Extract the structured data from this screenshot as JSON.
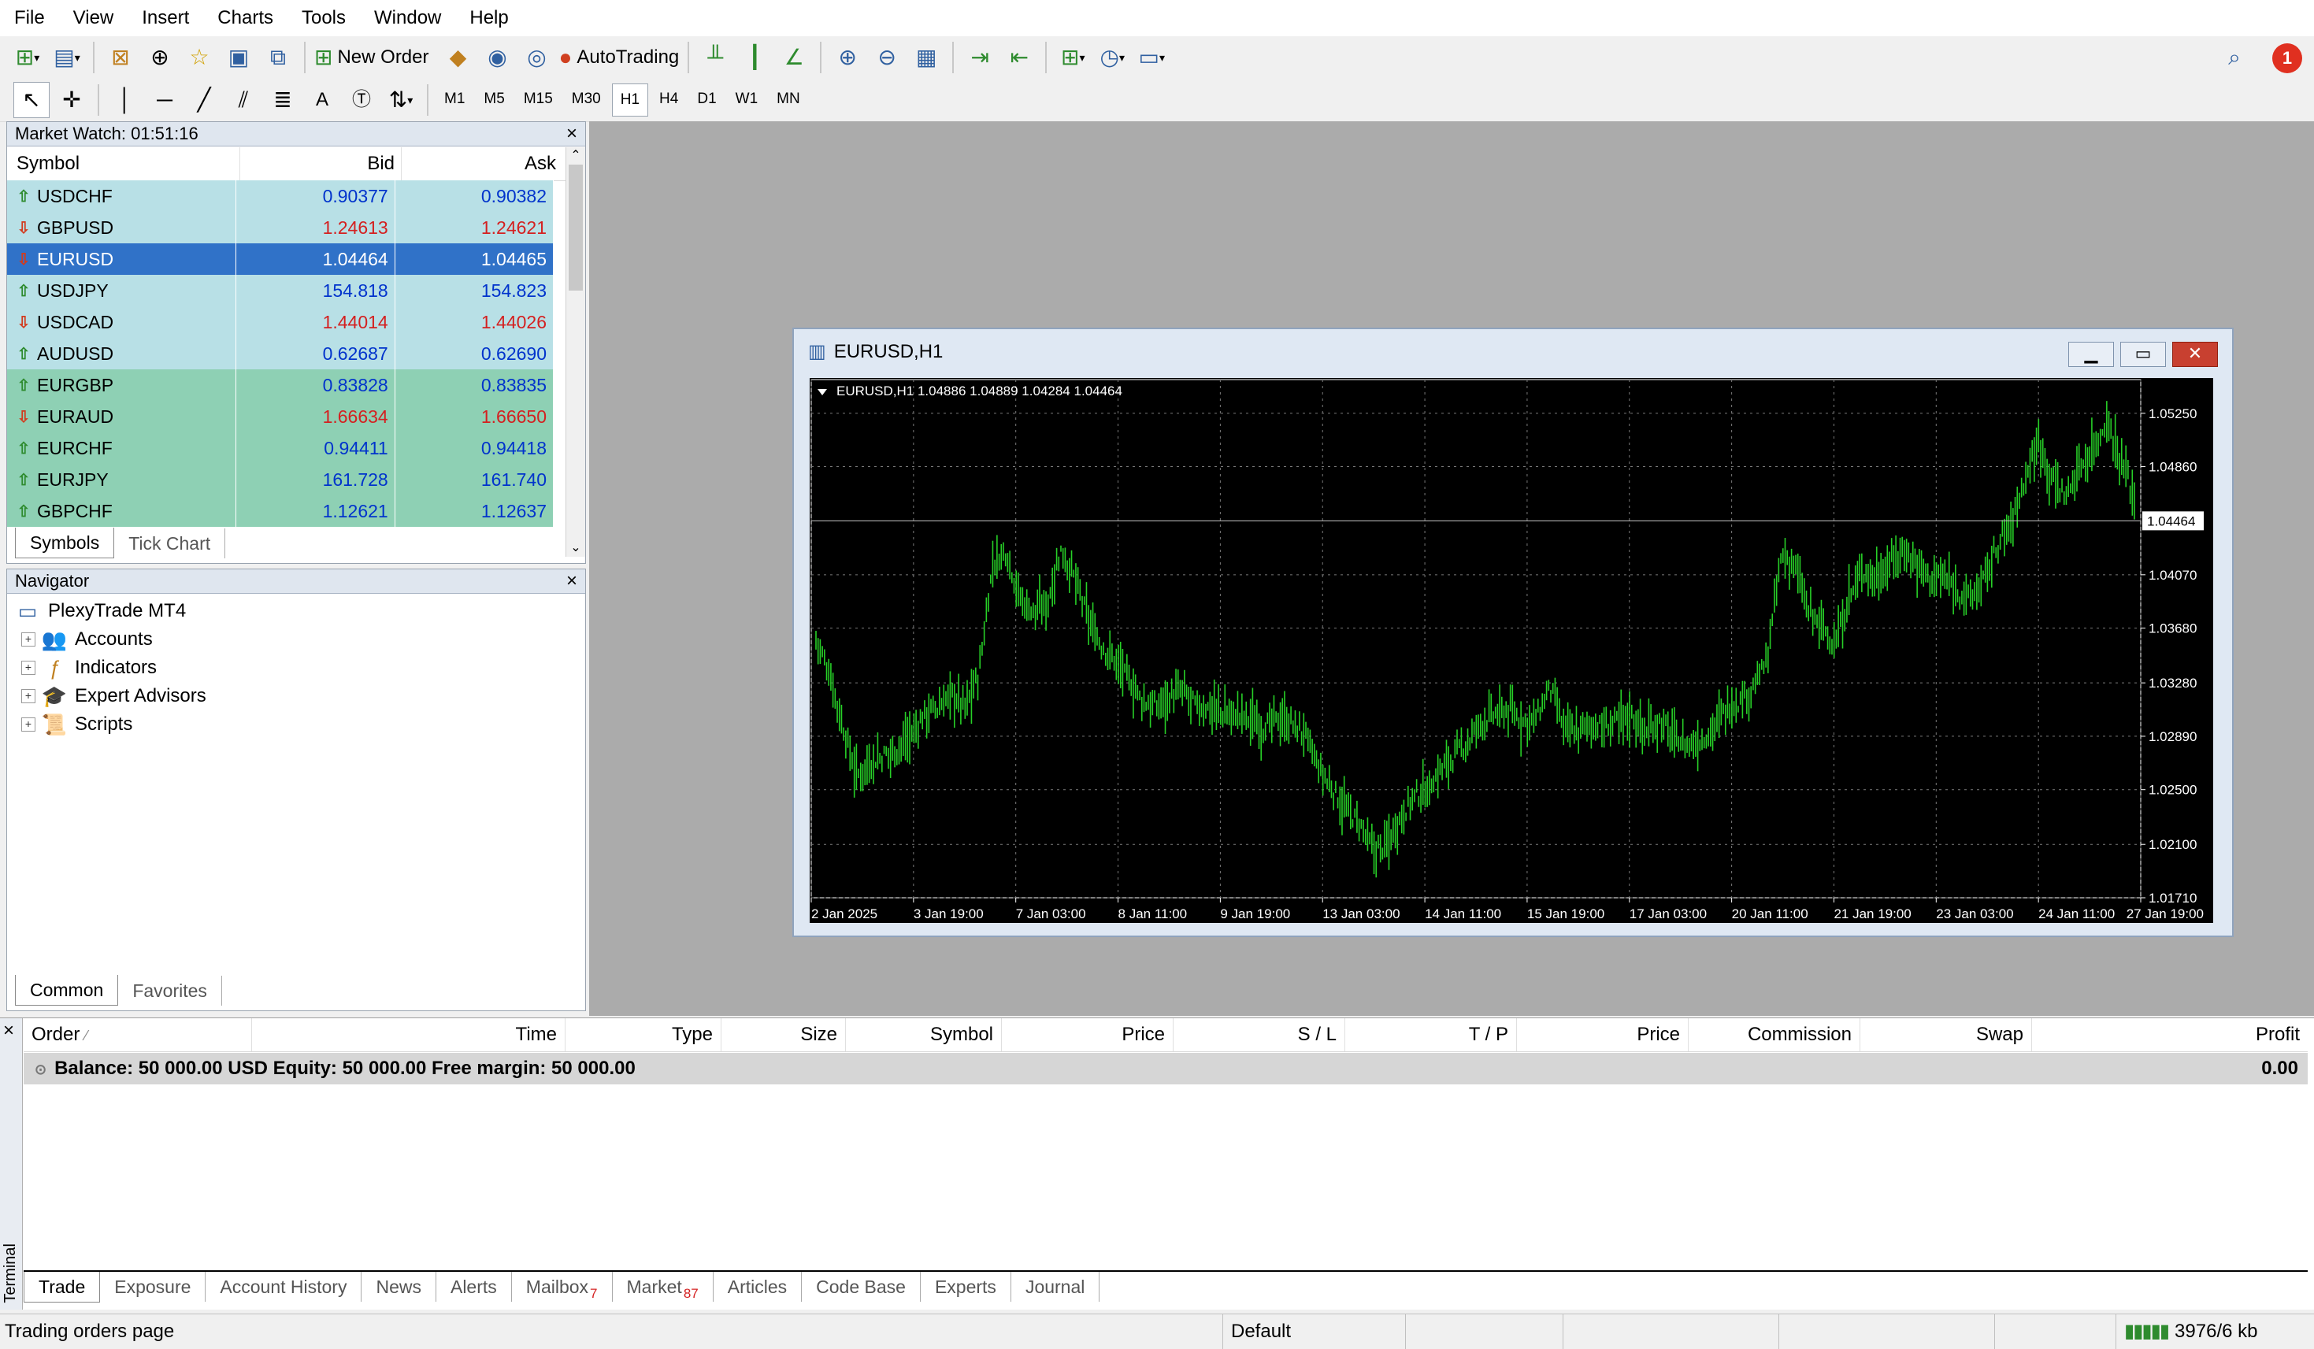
{
  "menu": [
    "File",
    "View",
    "Insert",
    "Charts",
    "Tools",
    "Window",
    "Help"
  ],
  "toolbar": {
    "new_order": "New Order",
    "autotrading": "AutoTrading",
    "alert_count": "1"
  },
  "timeframes": [
    "M1",
    "M5",
    "M15",
    "M30",
    "H1",
    "H4",
    "D1",
    "W1",
    "MN"
  ],
  "active_timeframe": "H1",
  "market_watch": {
    "title": "Market Watch: 01:51:16",
    "columns": [
      "Symbol",
      "Bid",
      "Ask"
    ],
    "rows": [
      {
        "symbol": "USDCHF",
        "bid": "0.90377",
        "ask": "0.90382",
        "dir": "up",
        "color": "blue"
      },
      {
        "symbol": "GBPUSD",
        "bid": "1.24613",
        "ask": "1.24621",
        "dir": "down",
        "color": "red"
      },
      {
        "symbol": "EURUSD",
        "bid": "1.04464",
        "ask": "1.04465",
        "dir": "down",
        "color": "white",
        "selected": true
      },
      {
        "symbol": "USDJPY",
        "bid": "154.818",
        "ask": "154.823",
        "dir": "up",
        "color": "blue"
      },
      {
        "symbol": "USDCAD",
        "bid": "1.44014",
        "ask": "1.44026",
        "dir": "down",
        "color": "red"
      },
      {
        "symbol": "AUDUSD",
        "bid": "0.62687",
        "ask": "0.62690",
        "dir": "up",
        "color": "blue"
      },
      {
        "symbol": "EURGBP",
        "bid": "0.83828",
        "ask": "0.83835",
        "dir": "up",
        "color": "blue"
      },
      {
        "symbol": "EURAUD",
        "bid": "1.66634",
        "ask": "1.66650",
        "dir": "down",
        "color": "red"
      },
      {
        "symbol": "EURCHF",
        "bid": "0.94411",
        "ask": "0.94418",
        "dir": "up",
        "color": "blue"
      },
      {
        "symbol": "EURJPY",
        "bid": "161.728",
        "ask": "161.740",
        "dir": "up",
        "color": "blue"
      },
      {
        "symbol": "GBPCHF",
        "bid": "1.12621",
        "ask": "1.12637",
        "dir": "up",
        "color": "blue"
      }
    ],
    "tabs": [
      "Symbols",
      "Tick Chart"
    ]
  },
  "navigator": {
    "title": "Navigator",
    "root": "PlexyTrade MT4",
    "items": [
      "Accounts",
      "Indicators",
      "Expert Advisors",
      "Scripts"
    ],
    "tabs": [
      "Common",
      "Favorites"
    ]
  },
  "chart_window": {
    "title": "EURUSD,H1",
    "info": "EURUSD,H1  1.04886 1.04889 1.04284 1.04464",
    "current_price": "1.04464"
  },
  "chart_data": {
    "type": "bar",
    "symbol": "EURUSD",
    "timeframe": "H1",
    "ylim": [
      1.0171,
      1.0545
    ],
    "y_ticks": [
      "1.05250",
      "1.04860",
      "1.04070",
      "1.03680",
      "1.03280",
      "1.02890",
      "1.02500",
      "1.02100",
      "1.01710"
    ],
    "y_tick_values": [
      1.0525,
      1.0486,
      1.0407,
      1.0368,
      1.0328,
      1.0289,
      1.025,
      1.021,
      1.0171
    ],
    "x_ticks": [
      "2 Jan 2025",
      "3 Jan 19:00",
      "7 Jan 03:00",
      "8 Jan 11:00",
      "9 Jan 19:00",
      "13 Jan 03:00",
      "14 Jan 11:00",
      "15 Jan 19:00",
      "17 Jan 03:00",
      "20 Jan 11:00",
      "21 Jan 19:00",
      "23 Jan 03:00",
      "24 Jan 11:00",
      "27 Jan 19:00"
    ],
    "current_price": 1.04464,
    "ohlc_last": {
      "open": 1.04886,
      "high": 1.04889,
      "low": 1.04284,
      "close": 1.04464
    },
    "series": [
      {
        "values": [
          1.036,
          1.0335,
          1.0295,
          1.026,
          1.027,
          1.0275,
          1.028,
          1.029,
          1.0305,
          1.031,
          1.032,
          1.031,
          1.0335,
          1.0415,
          1.0425,
          1.039,
          1.038,
          1.0385,
          1.0425,
          1.0405,
          1.0375,
          1.0355,
          1.0345,
          1.033,
          1.0315,
          1.031,
          1.0318,
          1.0322,
          1.031,
          1.031,
          1.0305,
          1.0305,
          1.0302,
          1.0295,
          1.0302,
          1.0298,
          1.029,
          1.0265,
          1.025,
          1.0235,
          1.0225,
          1.0205,
          1.021,
          1.023,
          1.0245,
          1.025,
          1.0265,
          1.0275,
          1.0285,
          1.03,
          1.0305,
          1.0308,
          1.03,
          1.0302,
          1.0325,
          1.0295,
          1.0292,
          1.0298,
          1.0295,
          1.03,
          1.0305,
          1.0292,
          1.03,
          1.029,
          1.0282,
          1.0285,
          1.0295,
          1.031,
          1.0315,
          1.0325,
          1.0345,
          1.042,
          1.0415,
          1.038,
          1.037,
          1.0355,
          1.039,
          1.041,
          1.0405,
          1.0415,
          1.0425,
          1.0415,
          1.0405,
          1.0405,
          1.0395,
          1.039,
          1.0405,
          1.043,
          1.0445,
          1.048,
          1.0505,
          1.0475,
          1.0465,
          1.0485,
          1.05,
          1.052,
          1.049,
          1.0465
        ]
      }
    ]
  },
  "terminal": {
    "label": "Terminal",
    "columns": [
      "Order",
      "Time",
      "Type",
      "Size",
      "Symbol",
      "Price",
      "S / L",
      "T / P",
      "Price",
      "Commission",
      "Swap",
      "Profit"
    ],
    "balance_text": "Balance: 50 000.00 USD  Equity: 50 000.00  Free margin: 50 000.00",
    "profit_total": "0.00",
    "tabs": [
      {
        "label": "Trade"
      },
      {
        "label": "Exposure"
      },
      {
        "label": "Account History"
      },
      {
        "label": "News"
      },
      {
        "label": "Alerts"
      },
      {
        "label": "Mailbox",
        "badge": "7"
      },
      {
        "label": "Market",
        "badge": "87"
      },
      {
        "label": "Articles"
      },
      {
        "label": "Code Base"
      },
      {
        "label": "Experts"
      },
      {
        "label": "Journal"
      }
    ]
  },
  "status": {
    "left": "Trading orders page",
    "profile": "Default",
    "traffic": "3976/6 kb"
  }
}
